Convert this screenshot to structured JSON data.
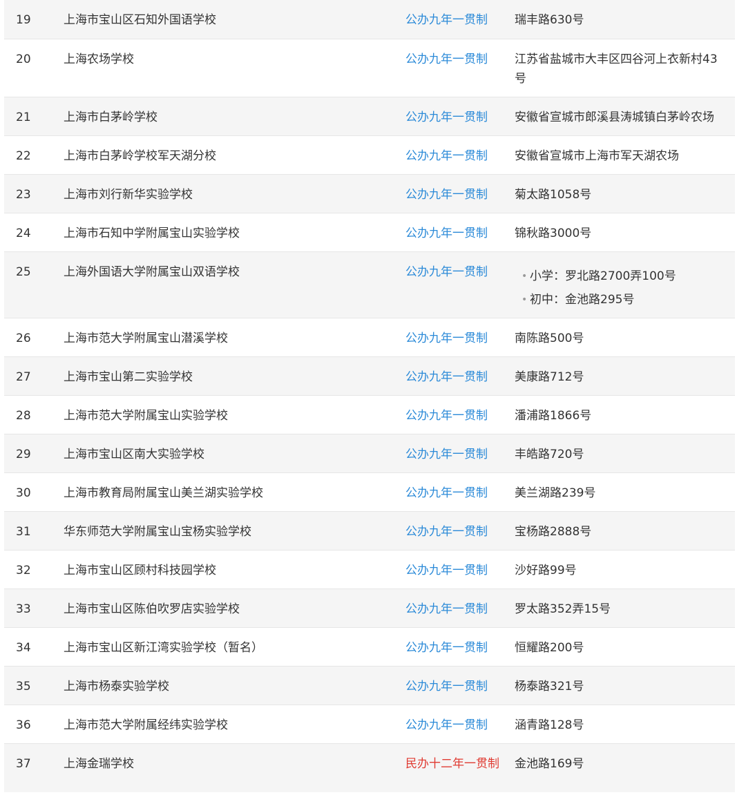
{
  "schools": [
    {
      "num": "19",
      "name": "上海市宝山区石知外国语学校",
      "type": "公办九年一贯制",
      "address": "瑞丰路630号"
    },
    {
      "num": "20",
      "name": "上海农场学校",
      "type": "公办九年一贯制",
      "address": "江苏省盐城市大丰区四谷河上衣新村43号"
    },
    {
      "num": "21",
      "name": "上海市白茅岭学校",
      "type": "公办九年一贯制",
      "address": "安徽省宣城市郎溪县涛城镇白茅岭农场"
    },
    {
      "num": "22",
      "name": "上海市白茅岭学校军天湖分校",
      "type": "公办九年一贯制",
      "address": "安徽省宣城市上海市军天湖农场"
    },
    {
      "num": "23",
      "name": "上海市刘行新华实验学校",
      "type": "公办九年一贯制",
      "address": "菊太路1058号"
    },
    {
      "num": "24",
      "name": "上海市石知中学附属宝山实验学校",
      "type": "公办九年一贯制",
      "address": "锦秋路3000号"
    },
    {
      "num": "25",
      "name": "上海外国语大学附属宝山双语学校",
      "type": "公办九年一贯制",
      "address_list": [
        "小学：罗北路2700弄100号",
        "初中：金池路295号"
      ]
    },
    {
      "num": "26",
      "name": "上海市范大学附属宝山潜溪学校",
      "type": "公办九年一贯制",
      "address": "南陈路500号"
    },
    {
      "num": "27",
      "name": "上海市宝山第二实验学校",
      "type": "公办九年一贯制",
      "address": "美康路712号"
    },
    {
      "num": "28",
      "name": "上海市范大学附属宝山实验学校",
      "type": "公办九年一贯制",
      "address": "潘浦路1866号"
    },
    {
      "num": "29",
      "name": "上海市宝山区南大实验学校",
      "type": "公办九年一贯制",
      "address": "丰皓路720号"
    },
    {
      "num": "30",
      "name": "上海市教育局附属宝山美兰湖实验学校",
      "type": "公办九年一贯制",
      "address": "美兰湖路239号"
    },
    {
      "num": "31",
      "name": "华东师范大学附属宝山宝杨实验学校",
      "type": "公办九年一贯制",
      "address": "宝杨路2888号"
    },
    {
      "num": "32",
      "name": "上海市宝山区顾村科技园学校",
      "type": "公办九年一贯制",
      "address": "沙好路99号"
    },
    {
      "num": "33",
      "name": "上海市宝山区陈伯吹罗店实验学校",
      "type": "公办九年一贯制",
      "address": "罗太路352弄15号"
    },
    {
      "num": "34",
      "name": "上海市宝山区新江湾实验学校（暂名）",
      "type": "公办九年一贯制",
      "address": "恒耀路200号"
    },
    {
      "num": "35",
      "name": "上海市杨泰实验学校",
      "type": "公办九年一贯制",
      "address": "杨泰路321号"
    },
    {
      "num": "36",
      "name": "上海市范大学附属经纬实验学校",
      "type": "公办九年一贯制",
      "address": "涵青路128号"
    },
    {
      "num": "37",
      "name": "上海金瑞学校",
      "type": "民办十二年一贯制",
      "address": "金池路169号"
    }
  ],
  "colors": {
    "public_type": "#2b8ad8",
    "private_type": "#e03b32",
    "row_stripe": "#f5f5f5",
    "text": "#333333"
  }
}
